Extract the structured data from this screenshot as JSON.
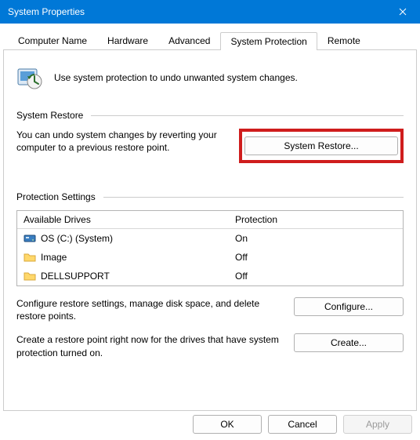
{
  "window": {
    "title": "System Properties"
  },
  "tabs": [
    {
      "label": "Computer Name"
    },
    {
      "label": "Hardware"
    },
    {
      "label": "Advanced"
    },
    {
      "label": "System Protection",
      "active": true
    },
    {
      "label": "Remote"
    }
  ],
  "intro": "Use system protection to undo unwanted system changes.",
  "groups": {
    "system_restore": {
      "title": "System Restore",
      "text": "You can undo system changes by reverting your computer to a previous restore point.",
      "button": "System Restore..."
    },
    "protection_settings": {
      "title": "Protection Settings",
      "header_drive": "Available Drives",
      "header_protection": "Protection",
      "drives": [
        {
          "name": "OS (C:) (System)",
          "protection": "On",
          "icon": "disk"
        },
        {
          "name": "Image",
          "protection": "Off",
          "icon": "folder"
        },
        {
          "name": "DELLSUPPORT",
          "protection": "Off",
          "icon": "folder"
        }
      ],
      "configure_text": "Configure restore settings, manage disk space, and delete restore points.",
      "configure_button": "Configure...",
      "create_text": "Create a restore point right now for the drives that have system protection turned on.",
      "create_button": "Create..."
    }
  },
  "buttons": {
    "ok": "OK",
    "cancel": "Cancel",
    "apply": "Apply"
  },
  "colors": {
    "highlight": "#cf1d1d",
    "titlebar": "#0078d7"
  }
}
